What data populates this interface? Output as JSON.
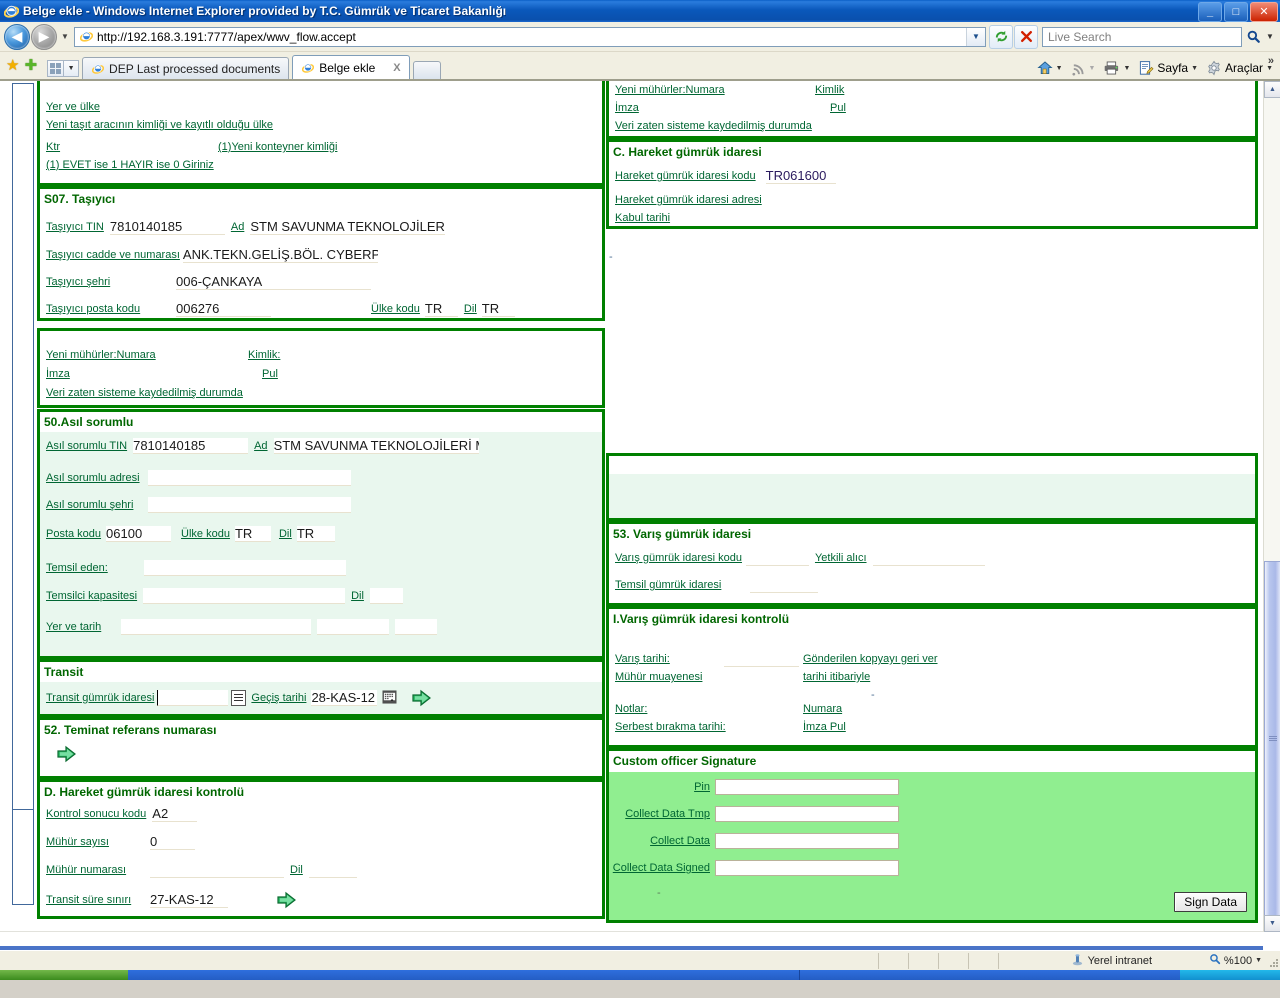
{
  "window": {
    "title": "Belge ekle - Windows Internet Explorer provided by T.C. Gümrük ve Ticaret Bakanlığı",
    "minimize_label": "_",
    "maximize_label": "□",
    "close_label": "✕"
  },
  "nav": {
    "back_label": "◀",
    "forward_label": "▶",
    "history_caret": "▼",
    "address_value": "http://192.168.3.191:7777/apex/wwv_flow.accept",
    "address_dropdown": "▼",
    "refresh_label": "↻",
    "stop_label": "✕",
    "search_placeholder": "Live Search",
    "search_go": "🔍",
    "search_caret": "▼"
  },
  "tabs": {
    "fav_star": "★",
    "fav_add": "✚",
    "quick_caret": "▼",
    "items": [
      {
        "label": "DEP Last processed documents",
        "active": false
      },
      {
        "label": "Belge ekle",
        "active": true,
        "close": "X"
      }
    ]
  },
  "commandbar": {
    "home": "Home",
    "feeds": "Feeds",
    "print": "Print",
    "page": "Sayfa",
    "tools": "Araçlar",
    "overflow": "»",
    "caret": "▼"
  },
  "form": {
    "top_left": {
      "links": [
        "Yer ve ülke",
        "Yeni taşıt aracının kimliği ve kayıtlı olduğu ülke"
      ],
      "ktr_label": "Ktr",
      "ktr_link": "(1)Yeni konteyner kimliği",
      "note": "(1) EVET ise 1 HAYIR ise 0 Giriniz"
    },
    "carrier": {
      "title": "S07. Taşıyıcı",
      "tin_label": "Taşıyıcı TIN",
      "tin_value": "7810140185",
      "name_label": "Ad",
      "name_value": "STM SAVUNMA TEKNOLOJİLERİ M",
      "street_label": "Taşıyıcı cadde ve numarası",
      "street_value": "ANK.TEKN.GELİŞ.BÖL. CYBERPAI",
      "city_label": "Taşıyıcı şehri",
      "city_value": "006-ÇANKAYA",
      "post_label": "Taşıyıcı posta kodu",
      "post_value": "006276",
      "country_label": "Ülke kodu",
      "country_value": "TR",
      "lang_label": "Dil",
      "lang_value": "TR"
    },
    "seals_left": {
      "numara_label": "Yeni mühürler:Numara",
      "kimlik_label": "Kimlik:",
      "imza_label": "İmza",
      "pul_label": "Pul",
      "saved_label": "Veri zaten sisteme kaydedilmiş durumda"
    },
    "principal": {
      "title": "50.Asıl sorumlu",
      "tin_label": "Asıl sorumlu TIN",
      "tin_value": "7810140185",
      "name_label": "Ad",
      "name_value": "STM SAVUNMA TEKNOLOJİLERİ MÜH",
      "address_label": "Asıl sorumlu adresi",
      "address_value": "",
      "city_label": "Asıl sorumlu şehri",
      "city_value": "",
      "post_label": "Posta kodu",
      "post_value": "06100",
      "country_label": "Ülke kodu",
      "country_value": "TR",
      "lang_label": "Dil",
      "lang_value": "TR",
      "rep_label": "Temsil eden:",
      "rep_value": "",
      "repcap_label": "Temsilci kapasitesi",
      "repcap_value": "",
      "repcap_lang_label": "Dil",
      "repcap_lang_value": "",
      "place_label": "Yer ve tarih",
      "place_value": ""
    },
    "transit": {
      "title": "Transit",
      "office_label": "Transit gümrük idaresi",
      "office_value": "",
      "passdate_label": "Geçiş tarihi",
      "passdate_value": "28-KAS-12"
    },
    "guarantee": {
      "title": "52. Teminat referans numarası"
    },
    "dep_control": {
      "title": "D. Hareket gümrük idaresi kontrolü",
      "result_label": "Kontrol sonucu kodu",
      "result_value": "A2",
      "sealcount_label": "Mühür sayısı",
      "sealcount_value": "0",
      "sealno_label": "Mühür numarası",
      "sealno_value": "",
      "sealno_lang_label": "Dil",
      "sealno_lang_value": "",
      "limit_label": "Transit süre sınırı",
      "limit_value": "27-KAS-12"
    },
    "seals_right": {
      "numara_label": "Yeni mühürler:Numara",
      "kimlik_label": "Kimlik",
      "imza_label": "İmza",
      "pul_label": "Pul",
      "saved_label": "Veri zaten sisteme kaydedilmiş durumda"
    },
    "departure_office": {
      "title": "C. Hareket gümrük idaresi",
      "code_label": "Hareket gümrük idaresi kodu",
      "code_value": "TR061600",
      "address_label": "Hareket gümrük idaresi adresi",
      "accept_label": "Kabul tarihi"
    },
    "middle_dash": "-",
    "destination_office": {
      "title": "53. Varış gümrük idaresi",
      "code_label": "Varış gümrük idaresi kodu",
      "code_value": "",
      "authorized_label": "Yetkili alıcı",
      "authorized_value": "",
      "rep_label": "Temsil gümrük idaresi",
      "rep_value": ""
    },
    "destination_control": {
      "title": "I.Varış gümrük idaresi kontrolü",
      "arrival_label": "Varış tarihi:",
      "arrival_value": "",
      "returncopy_label": "Gönderilen kopyayı geri ver",
      "sealcheck_label": "Mühür muayenesi",
      "asof_label": "tarihi itibariyle",
      "dash": "-",
      "notes_label": "Notlar:",
      "number_label": "Numara",
      "release_label": "Serbest bırakma tarihi:",
      "stamp_label": "İmza Pul"
    },
    "signature": {
      "title": "Custom officer Signature",
      "pin_label": "Pin",
      "pin_value": "",
      "tmp_label": "Collect Data Tmp",
      "tmp_value": "",
      "data_label": "Collect Data",
      "data_value": "",
      "signed_label": "Collect Data Signed",
      "signed_value": "",
      "dash": "-",
      "button_label": "Sign Data"
    }
  },
  "scroll": {
    "up_arrow": "▲",
    "down_arrow": "▼"
  },
  "status": {
    "zone_label": "Yerel intranet",
    "zoom_label": "%100",
    "zoom_caret": "▼"
  },
  "colors": {
    "panel_border": "#008000",
    "label_green": "#006633",
    "title_green": "#006600",
    "tint": "#e9f7ee",
    "signature_green": "#90ee90"
  }
}
